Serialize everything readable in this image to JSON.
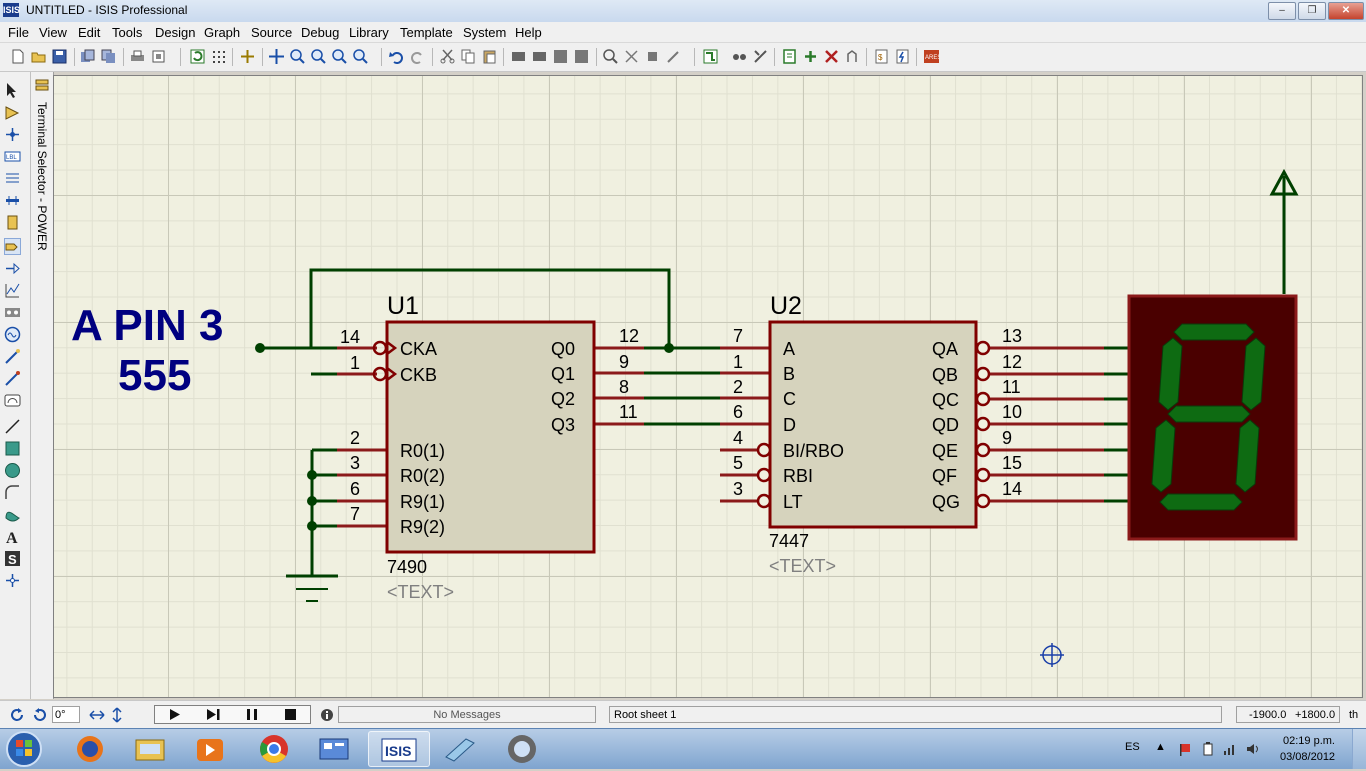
{
  "window": {
    "title": "UNTITLED - ISIS Professional",
    "app_icon": "ISIS"
  },
  "menu": [
    "File",
    "View",
    "Edit",
    "Tools",
    "Design",
    "Graph",
    "Source",
    "Debug",
    "Library",
    "Template",
    "System",
    "Help"
  ],
  "selector": {
    "title": "Terminal Selector - POWER"
  },
  "schematic": {
    "annotation_line1": "A PIN 3",
    "annotation_line2": "555",
    "u1": {
      "ref": "U1",
      "part": "7490",
      "text": "<TEXT>",
      "left_pins": [
        {
          "num": "14",
          "name": "CKA"
        },
        {
          "num": "1",
          "name": "CKB"
        },
        {
          "num": "2",
          "name": "R0(1)"
        },
        {
          "num": "3",
          "name": "R0(2)"
        },
        {
          "num": "6",
          "name": "R9(1)"
        },
        {
          "num": "7",
          "name": "R9(2)"
        }
      ],
      "right_pins": [
        {
          "num": "12",
          "name": "Q0"
        },
        {
          "num": "9",
          "name": "Q1"
        },
        {
          "num": "8",
          "name": "Q2"
        },
        {
          "num": "11",
          "name": "Q3"
        }
      ]
    },
    "u2": {
      "ref": "U2",
      "part": "7447",
      "text": "<TEXT>",
      "left_pins": [
        {
          "num": "7",
          "name": "A"
        },
        {
          "num": "1",
          "name": "B"
        },
        {
          "num": "2",
          "name": "C"
        },
        {
          "num": "6",
          "name": "D"
        },
        {
          "num": "4",
          "name": "BI/RBO"
        },
        {
          "num": "5",
          "name": "RBI"
        },
        {
          "num": "3",
          "name": "LT"
        }
      ],
      "right_pins": [
        {
          "num": "13",
          "name": "QA"
        },
        {
          "num": "12",
          "name": "QB"
        },
        {
          "num": "11",
          "name": "QC"
        },
        {
          "num": "10",
          "name": "QD"
        },
        {
          "num": "9",
          "name": "QE"
        },
        {
          "num": "15",
          "name": "QF"
        },
        {
          "num": "14",
          "name": "QG"
        }
      ]
    },
    "display": {
      "shown_digit": "8"
    }
  },
  "status": {
    "rotation": "0°",
    "messages": "No Messages",
    "sheet": "Root sheet 1",
    "coord_x": "-1900.0",
    "coord_y": "+1800.0",
    "units": "th"
  },
  "taskbar": {
    "language": "ES",
    "time": "02:19 p.m.",
    "date": "03/08/2012"
  },
  "colors": {
    "component_body": "#d6d3bd",
    "component_border": "#800000",
    "wire": "#004000",
    "annotation": "#000080",
    "segment_on": "#0e6b12",
    "display_bg": "#4a0000"
  }
}
